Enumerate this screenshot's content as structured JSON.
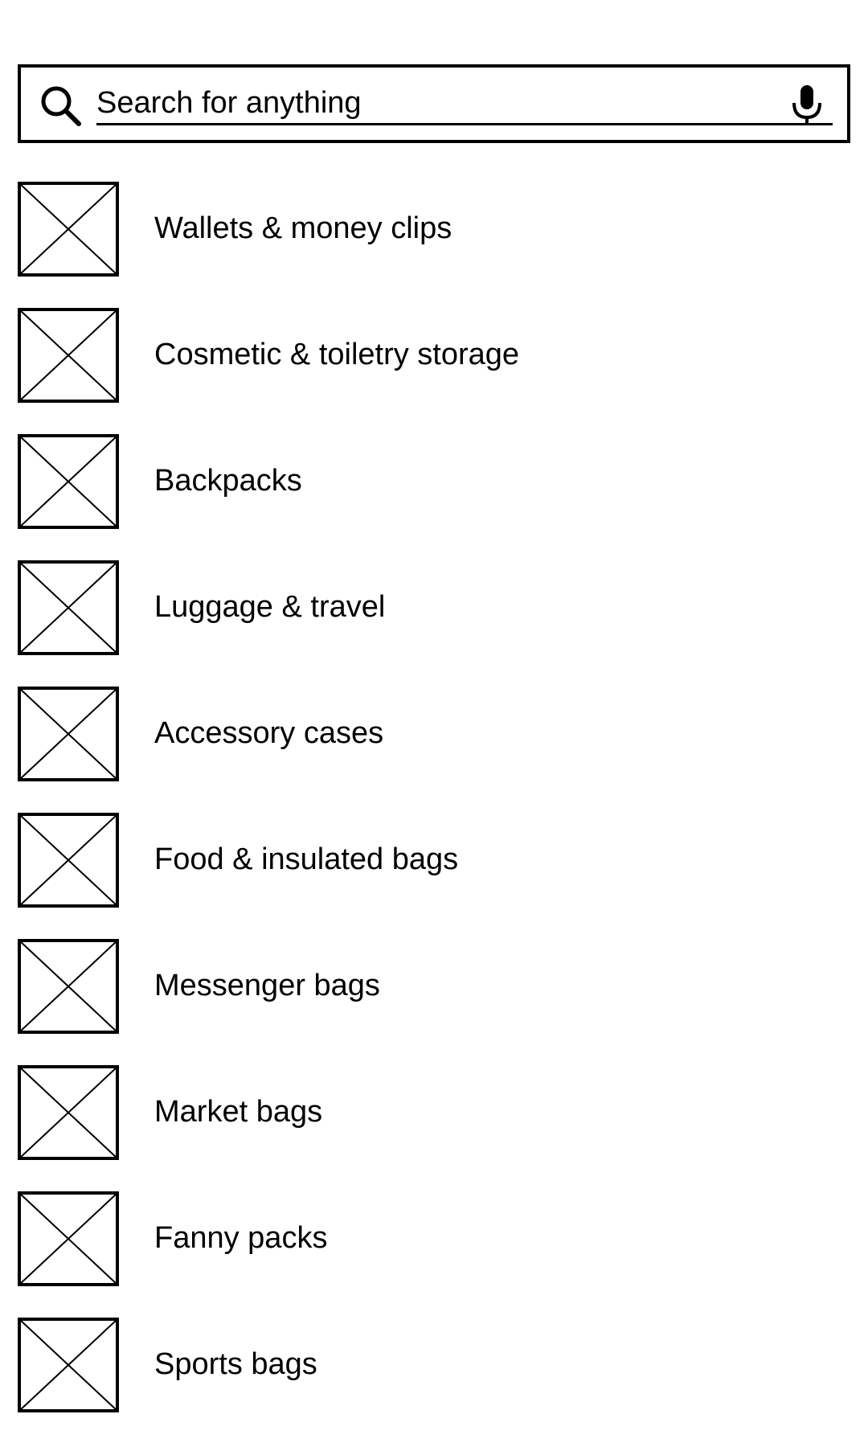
{
  "search": {
    "placeholder": "Search for anything",
    "value": "",
    "search_icon": "search-icon",
    "mic_icon": "microphone-icon"
  },
  "categories": [
    {
      "label": "Wallets & money clips",
      "icon": "image-placeholder-icon"
    },
    {
      "label": "Cosmetic & toiletry storage",
      "icon": "image-placeholder-icon"
    },
    {
      "label": "Backpacks",
      "icon": "image-placeholder-icon"
    },
    {
      "label": "Luggage & travel",
      "icon": "image-placeholder-icon"
    },
    {
      "label": "Accessory cases",
      "icon": "image-placeholder-icon"
    },
    {
      "label": "Food & insulated bags",
      "icon": "image-placeholder-icon"
    },
    {
      "label": "Messenger bags",
      "icon": "image-placeholder-icon"
    },
    {
      "label": "Market bags",
      "icon": "image-placeholder-icon"
    },
    {
      "label": "Fanny packs",
      "icon": "image-placeholder-icon"
    },
    {
      "label": "Sports bags",
      "icon": "image-placeholder-icon"
    }
  ],
  "colors": {
    "foreground": "#000000",
    "background": "#ffffff"
  }
}
